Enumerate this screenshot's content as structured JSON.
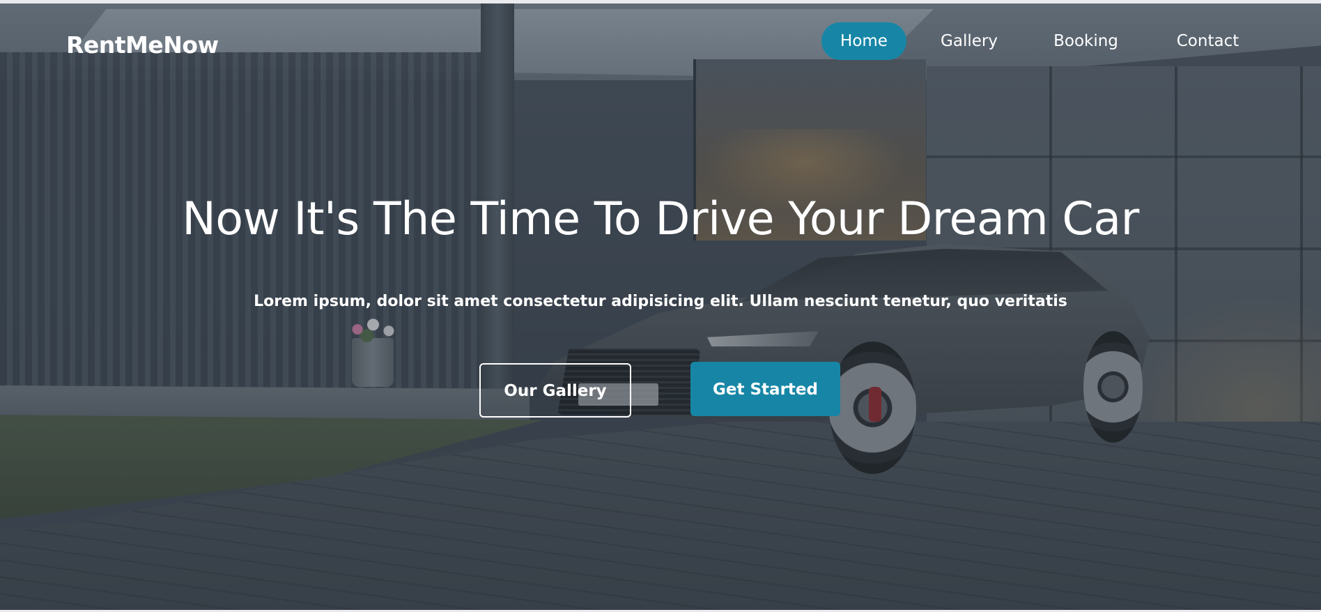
{
  "brand": {
    "name": "RentMeNow"
  },
  "nav": {
    "items": [
      {
        "label": "Home",
        "active": true
      },
      {
        "label": "Gallery",
        "active": false
      },
      {
        "label": "Booking",
        "active": false
      },
      {
        "label": "Contact",
        "active": false
      }
    ]
  },
  "hero": {
    "headline": "Now It's The Time To Drive Your Dream Car",
    "subtitle": "Lorem ipsum, dolor sit amet consectetur adipisicing elit. Ullam nesciunt tenetur, quo veritatis",
    "background_image": "car-in-driveway-photo",
    "buttons": {
      "secondary_label": "Our Gallery",
      "primary_label": "Get Started"
    }
  },
  "colors": {
    "accent": "#1786a6",
    "text": "#ffffff"
  }
}
